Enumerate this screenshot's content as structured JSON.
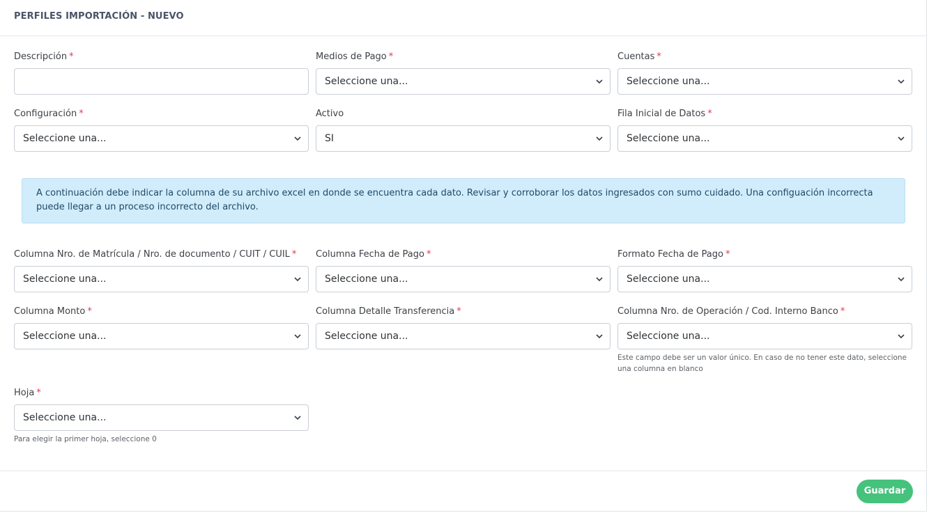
{
  "header": {
    "title": "PERFILES IMPORTACIÓN - NUEVO"
  },
  "required_mark": "*",
  "fields": {
    "descripcion": {
      "label": "Descripción",
      "value": ""
    },
    "medios_pago": {
      "label": "Medios de Pago",
      "value": "Seleccione una..."
    },
    "cuentas": {
      "label": "Cuentas",
      "value": "Seleccione una..."
    },
    "configuracion": {
      "label": "Configuración",
      "value": "Seleccione una..."
    },
    "activo": {
      "label": "Activo",
      "value": "SI"
    },
    "fila_inicial": {
      "label": "Fila Inicial de Datos",
      "value": "Seleccione una..."
    },
    "col_matricula": {
      "label": "Columna Nro. de Matrícula / Nro. de documento / CUIT / CUIL",
      "value": "Seleccione una..."
    },
    "col_fecha_pago": {
      "label": "Columna Fecha de Pago",
      "value": "Seleccione una..."
    },
    "formato_fecha": {
      "label": "Formato Fecha de Pago",
      "value": "Seleccione una..."
    },
    "col_monto": {
      "label": "Columna Monto",
      "value": "Seleccione una..."
    },
    "col_detalle": {
      "label": "Columna Detalle Transferencia",
      "value": "Seleccione una..."
    },
    "col_operacion": {
      "label": "Columna Nro. de Operación / Cod. Interno Banco",
      "value": "Seleccione una...",
      "help": "Este campo debe ser un valor único. En caso de no tener este dato, seleccione una columna en blanco"
    },
    "hoja": {
      "label": "Hoja",
      "value": "Seleccione una...",
      "help": "Para elegir la primer hoja, seleccione 0"
    }
  },
  "alert": {
    "text": "A continuación debe indicar la columna de su archivo excel en donde se encuentra cada dato. Revisar y corroborar los datos ingresados con sumo cuidado. Una configuación incorrecta puede llegar a un proceso incorrecto del archivo."
  },
  "footer": {
    "save_label": "Guardar"
  },
  "colors": {
    "accent": "#45c27c",
    "required": "#e03b4f",
    "alert_bg": "#d1ecfb"
  }
}
